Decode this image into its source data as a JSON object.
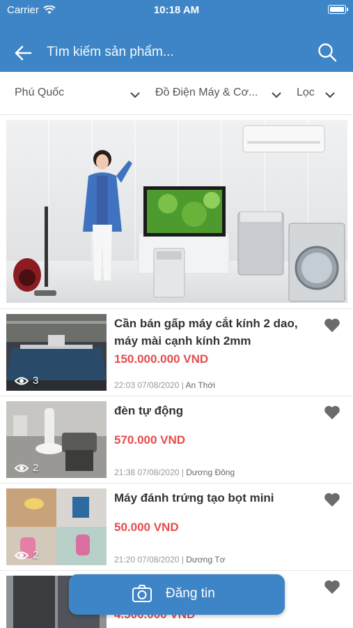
{
  "status": {
    "carrier": "Carrier",
    "time": "10:18 AM"
  },
  "search": {
    "placeholder": "Tìm kiếm sản phẩm..."
  },
  "filters": {
    "location": "Phú Quốc",
    "category": "Đồ Điện Máy & Cơ...",
    "filter": "Lọc"
  },
  "listings": [
    {
      "title": "Cần bán gấp máy cắt kính 2 dao, máy mài cạnh kính 2mm",
      "price": "150.000.000 VND",
      "time": "22:03 07/08/2020",
      "location": "An Thới",
      "views": "3"
    },
    {
      "title": "đèn tự động",
      "price": "570.000 VND",
      "time": "21:38 07/08/2020",
      "location": "Dương Đông",
      "views": "2"
    },
    {
      "title": "Máy đánh trứng tạo bọt mini",
      "price": "50.000 VND",
      "time": "21:20 07/08/2020",
      "location": "Dương Tơ",
      "views": "2"
    },
    {
      "title": "",
      "price": "4.500.000 VND",
      "time": "",
      "location": "",
      "views": ""
    }
  ],
  "post_button": {
    "label": "Đăng tin"
  },
  "colors": {
    "primary": "#3d85c6",
    "price": "#e74c4c",
    "heart": "#6b6b6b"
  },
  "icons": [
    "wifi-icon",
    "battery-icon",
    "back-arrow-icon",
    "search-icon",
    "chevron-down-icon",
    "eye-icon",
    "heart-icon",
    "camera-icon"
  ]
}
